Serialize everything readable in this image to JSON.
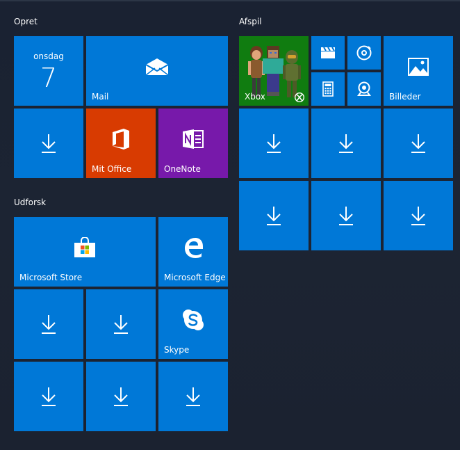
{
  "groups": {
    "opret": "Opret",
    "udforsk": "Udforsk",
    "afspil": "Afspil"
  },
  "tiles": {
    "calendar": {
      "weekday": "onsdag",
      "day": "7"
    },
    "mail": "Mail",
    "office": "Mit Office",
    "onenote": "OneNote",
    "store": "Microsoft Store",
    "edge": "Microsoft Edge",
    "skype": "Skype",
    "xbox": "Xbox",
    "photos": "Billeder"
  },
  "icons": {
    "download": "download-arrow-icon",
    "mail": "envelope-icon",
    "office": "office-icon",
    "onenote": "onenote-icon",
    "store": "shopping-bag-icon",
    "edge": "edge-icon",
    "skype": "skype-icon",
    "movies": "clapperboard-icon",
    "groove": "music-disc-icon",
    "calculator": "calculator-icon",
    "camera": "webcam-icon",
    "photos": "picture-icon",
    "xbox": "xbox-logo-icon"
  },
  "colors": {
    "tile_blue": "#0078d7",
    "office_orange": "#d83b01",
    "onenote_purple": "#7719aa",
    "xbox_green": "#107c10",
    "background": "#1b2331"
  }
}
